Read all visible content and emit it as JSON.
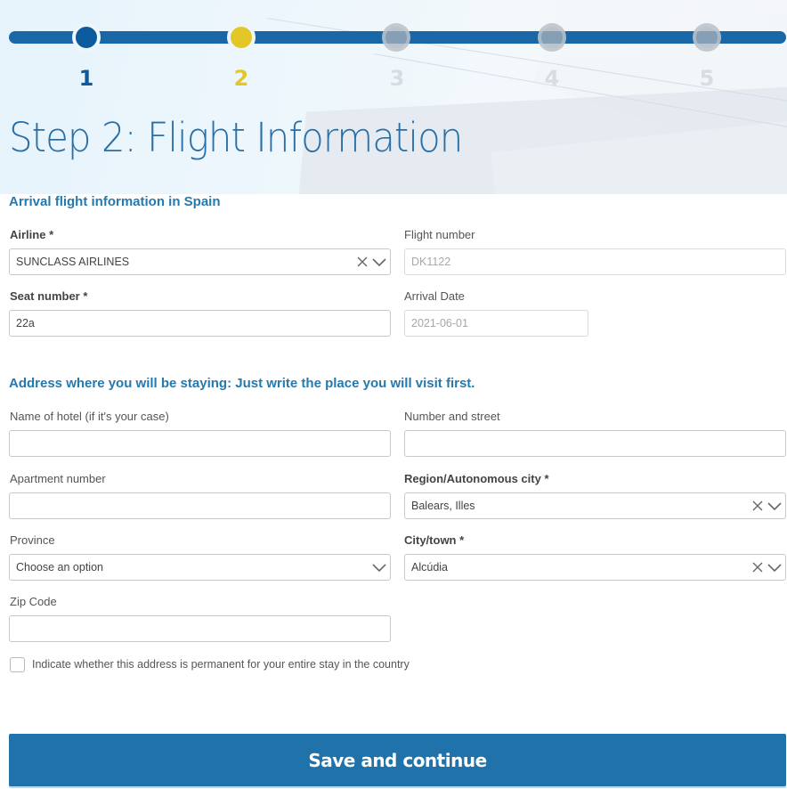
{
  "stepper": {
    "steps": [
      {
        "number": "1",
        "state": "done"
      },
      {
        "number": "2",
        "state": "current"
      },
      {
        "number": "3",
        "state": "todo"
      },
      {
        "number": "4",
        "state": "todo"
      },
      {
        "number": "5",
        "state": "todo"
      }
    ],
    "colors": {
      "track": "#1a67a8",
      "done": "#0b5b9e",
      "current": "#e3c726",
      "todo": "#aab2bc"
    }
  },
  "page": {
    "title": "Step 2: Flight Information"
  },
  "flight_section": {
    "title": "Arrival flight information in Spain",
    "airline": {
      "label": "Airline *",
      "value": "SUNCLASS AIRLINES"
    },
    "flight_number": {
      "label": "Flight number",
      "value": "DK1122"
    },
    "seat_number": {
      "label": "Seat number *",
      "value": "22a"
    },
    "arrival_date": {
      "label": "Arrival Date",
      "value": "2021-06-01"
    }
  },
  "address_section": {
    "title": "Address where you will be staying: Just write the place you will visit first.",
    "hotel_name": {
      "label": "Name of hotel (if it's your case)",
      "value": ""
    },
    "number_street": {
      "label": "Number and street",
      "value": ""
    },
    "apartment": {
      "label": "Apartment number",
      "value": ""
    },
    "region": {
      "label": "Region/Autonomous city *",
      "value": "Balears, Illes"
    },
    "province": {
      "label": "Province",
      "value": "Choose an option"
    },
    "city": {
      "label": "City/town *",
      "value": "Alcúdia"
    },
    "zip": {
      "label": "Zip Code",
      "value": ""
    },
    "permanent": {
      "label": "Indicate whether this address is permanent for your entire stay in the country",
      "checked": false
    }
  },
  "actions": {
    "save_label": "Save and continue"
  }
}
